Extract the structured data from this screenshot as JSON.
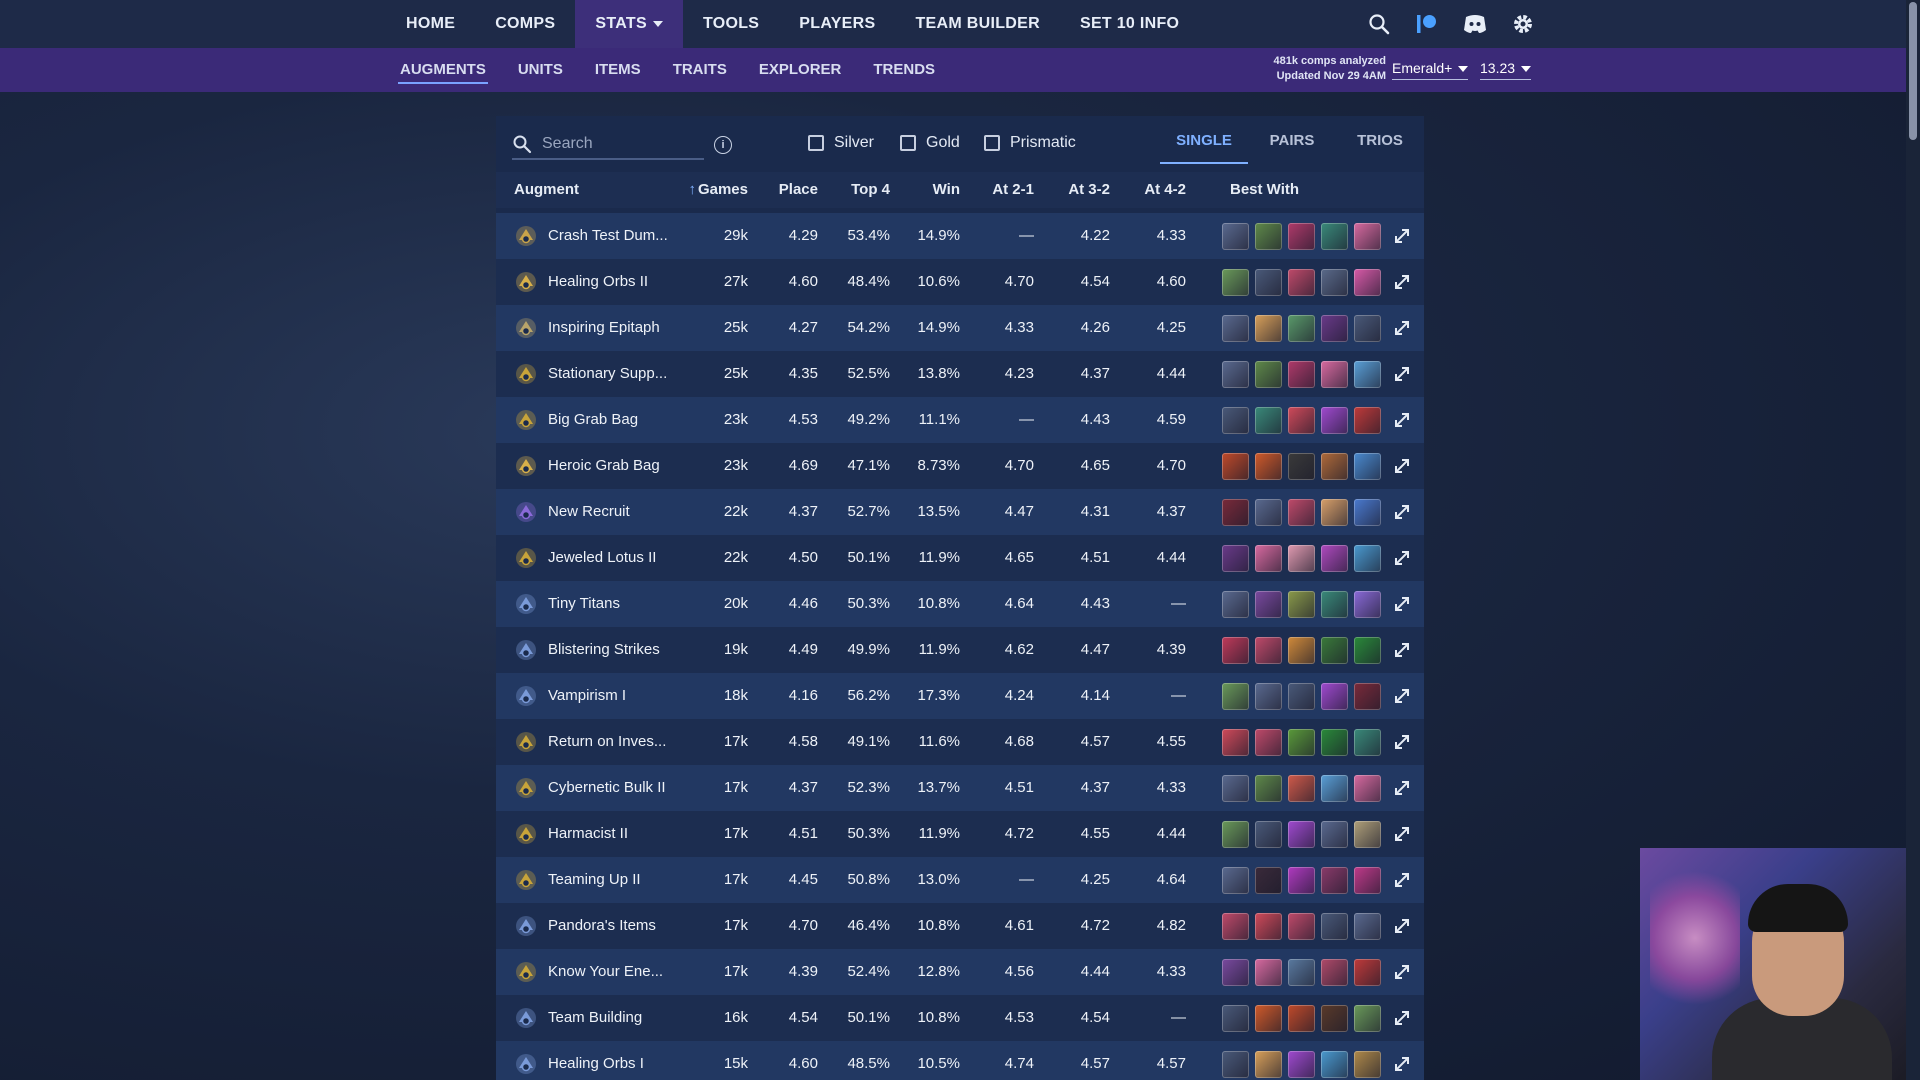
{
  "topnav": {
    "items": [
      {
        "label": "HOME"
      },
      {
        "label": "COMPS"
      },
      {
        "label": "STATS"
      },
      {
        "label": "TOOLS"
      },
      {
        "label": "PLAYERS"
      },
      {
        "label": "TEAM BUILDER"
      },
      {
        "label": "SET 10 INFO"
      }
    ],
    "active": "STATS"
  },
  "subnav": {
    "items": [
      {
        "label": "AUGMENTS"
      },
      {
        "label": "UNITS"
      },
      {
        "label": "ITEMS"
      },
      {
        "label": "TRAITS"
      },
      {
        "label": "EXPLORER"
      },
      {
        "label": "TRENDS"
      }
    ],
    "meta_line1": "481k comps analyzed",
    "meta_line2": "Updated Nov 29 4AM",
    "rank_filter": "Emerald+",
    "patch": "13.23"
  },
  "toolbar": {
    "search_placeholder": "Search",
    "filters": [
      {
        "label": "Silver"
      },
      {
        "label": "Gold"
      },
      {
        "label": "Prismatic"
      }
    ],
    "modes": [
      {
        "label": "SINGLE"
      },
      {
        "label": "PAIRS"
      },
      {
        "label": "TRIOS"
      }
    ]
  },
  "columns": {
    "augment": "Augment",
    "games": "Games",
    "place": "Place",
    "top4": "Top 4",
    "win": "Win",
    "at21": "At 2-1",
    "at32": "At 3-2",
    "at42": "At 4-2",
    "best": "Best With"
  },
  "rows": [
    {
      "name": "Crash Test Dum...",
      "games": "29k",
      "place": "4.29",
      "top4": "53.4%",
      "win": "14.9%",
      "at21": "—",
      "at32": "4.22",
      "at42": "4.33",
      "icon_color": "#c9a44a",
      "champs": [
        "#5a6a90",
        "#5f8a4a",
        "#b03a6a",
        "#3a8a7a",
        "#d86aa0"
      ]
    },
    {
      "name": "Healing Orbs II",
      "games": "27k",
      "place": "4.60",
      "top4": "48.4%",
      "win": "10.6%",
      "at21": "4.70",
      "at32": "4.54",
      "at42": "4.60",
      "icon_color": "#d8b04a",
      "champs": [
        "#6a9a5a",
        "#4a5a7a",
        "#c04a6a",
        "#5a6a8a",
        "#d85aa8"
      ]
    },
    {
      "name": "Inspiring Epitaph",
      "games": "25k",
      "place": "4.27",
      "top4": "54.2%",
      "win": "14.9%",
      "at21": "4.33",
      "at32": "4.26",
      "at42": "4.25",
      "icon_color": "#b8a46a",
      "champs": [
        "#5a6a90",
        "#d8a05a",
        "#5a9a6a",
        "#6a3a8a",
        "#4a5a7a"
      ]
    },
    {
      "name": "Stationary Supp...",
      "games": "25k",
      "place": "4.35",
      "top4": "52.5%",
      "win": "13.8%",
      "at21": "4.23",
      "at32": "4.37",
      "at42": "4.44",
      "icon_color": "#c8a43a",
      "champs": [
        "#5a6a90",
        "#5f8a4a",
        "#b03a6a",
        "#d86aa0",
        "#5aa0d8"
      ]
    },
    {
      "name": "Big Grab Bag",
      "games": "23k",
      "place": "4.53",
      "top4": "49.2%",
      "win": "11.1%",
      "at21": "—",
      "at32": "4.43",
      "at42": "4.59",
      "icon_color": "#c8a43a",
      "champs": [
        "#4a5a7a",
        "#3a8a7a",
        "#d04a5a",
        "#a04ad0",
        "#c03a3a"
      ]
    },
    {
      "name": "Heroic Grab Bag",
      "games": "23k",
      "place": "4.69",
      "top4": "47.1%",
      "win": "8.73%",
      "at21": "4.70",
      "at32": "4.65",
      "at42": "4.70",
      "icon_color": "#d8b04a",
      "champs": [
        "#c04a2a",
        "#d05a2a",
        "#3a3a3a",
        "#b06a3a",
        "#4a8ad0"
      ]
    },
    {
      "name": "New Recruit",
      "games": "22k",
      "place": "4.37",
      "top4": "52.7%",
      "win": "13.5%",
      "at21": "4.47",
      "at32": "4.31",
      "at42": "4.37",
      "icon_color": "#8a6ad8",
      "champs": [
        "#7a2a3a",
        "#5a6a90",
        "#c04a6a",
        "#d8a06a",
        "#4a7ad0"
      ]
    },
    {
      "name": "Jeweled Lotus II",
      "games": "22k",
      "place": "4.50",
      "top4": "50.1%",
      "win": "11.9%",
      "at21": "4.65",
      "at32": "4.51",
      "at42": "4.44",
      "icon_color": "#c8a43a",
      "champs": [
        "#6a3a8a",
        "#d86aa0",
        "#e09ab0",
        "#b04ac0",
        "#4a9ad0"
      ]
    },
    {
      "name": "Tiny Titans",
      "games": "20k",
      "place": "4.46",
      "top4": "50.3%",
      "win": "10.8%",
      "at21": "4.64",
      "at32": "4.43",
      "at42": "—",
      "icon_color": "#7a9ad8",
      "champs": [
        "#5a6a90",
        "#7a4aa0",
        "#8a9a4a",
        "#3a8a7a",
        "#8a6ad8"
      ]
    },
    {
      "name": "Blistering Strikes",
      "games": "19k",
      "place": "4.49",
      "top4": "49.9%",
      "win": "11.9%",
      "at21": "4.62",
      "at32": "4.47",
      "at42": "4.39",
      "icon_color": "#7a9ad8",
      "champs": [
        "#c03a5a",
        "#c04a6a",
        "#d08a3a",
        "#3a7a3a",
        "#2a8a3a"
      ]
    },
    {
      "name": "Vampirism I",
      "games": "18k",
      "place": "4.16",
      "top4": "56.2%",
      "win": "17.3%",
      "at21": "4.24",
      "at32": "4.14",
      "at42": "—",
      "icon_color": "#7a9ad8",
      "champs": [
        "#6a9a5a",
        "#5a6a90",
        "#4a5a7a",
        "#a04ad0",
        "#7a2a3a"
      ]
    },
    {
      "name": "Return on Inves...",
      "games": "17k",
      "place": "4.58",
      "top4": "49.1%",
      "win": "11.6%",
      "at21": "4.68",
      "at32": "4.57",
      "at42": "4.55",
      "icon_color": "#c8a43a",
      "champs": [
        "#d04a5a",
        "#c04a6a",
        "#5a9a3a",
        "#2a8a3a",
        "#3a8a7a"
      ]
    },
    {
      "name": "Cybernetic Bulk II",
      "games": "17k",
      "place": "4.37",
      "top4": "52.3%",
      "win": "13.7%",
      "at21": "4.51",
      "at32": "4.37",
      "at42": "4.33",
      "icon_color": "#c8a43a",
      "champs": [
        "#5a6a90",
        "#5f8a4a",
        "#d05a4a",
        "#5aa0d8",
        "#d86aa0"
      ]
    },
    {
      "name": "Harmacist II",
      "games": "17k",
      "place": "4.51",
      "top4": "50.3%",
      "win": "11.9%",
      "at21": "4.72",
      "at32": "4.55",
      "at42": "4.44",
      "icon_color": "#c8a43a",
      "champs": [
        "#6a9a5a",
        "#4a5a7a",
        "#a04ad0",
        "#5a6a90",
        "#b0a07a"
      ]
    },
    {
      "name": "Teaming Up II",
      "games": "17k",
      "place": "4.45",
      "top4": "50.8%",
      "win": "13.0%",
      "at21": "—",
      "at32": "4.25",
      "at42": "4.64",
      "icon_color": "#c8a43a",
      "champs": [
        "#5a6a90",
        "#3a2a3a",
        "#b03ac0",
        "#8a3a6a",
        "#c03a8a"
      ]
    },
    {
      "name": "Pandora's Items",
      "games": "17k",
      "place": "4.70",
      "top4": "46.4%",
      "win": "10.8%",
      "at21": "4.61",
      "at32": "4.72",
      "at42": "4.82",
      "icon_color": "#7a9ad8",
      "champs": [
        "#c04a6a",
        "#d04a5a",
        "#c04a6a",
        "#4a5a7a",
        "#5a6a90"
      ]
    },
    {
      "name": "Know Your Ene...",
      "games": "17k",
      "place": "4.39",
      "top4": "52.4%",
      "win": "12.8%",
      "at21": "4.56",
      "at32": "4.44",
      "at42": "4.33",
      "icon_color": "#c8a43a",
      "champs": [
        "#7a4aa0",
        "#d86aa0",
        "#5a7aa0",
        "#b04a6a",
        "#c03a3a"
      ]
    },
    {
      "name": "Team Building",
      "games": "16k",
      "place": "4.54",
      "top4": "50.1%",
      "win": "10.8%",
      "at21": "4.53",
      "at32": "4.54",
      "at42": "—",
      "icon_color": "#7a9ad8",
      "champs": [
        "#4a5a7a",
        "#d05a2a",
        "#c04a2a",
        "#5a3a2a",
        "#6a9a5a"
      ]
    },
    {
      "name": "Healing Orbs I",
      "games": "15k",
      "place": "4.60",
      "top4": "48.5%",
      "win": "10.5%",
      "at21": "4.74",
      "at32": "4.57",
      "at42": "4.57",
      "icon_color": "#7a9ad8",
      "champs": [
        "#4a5a7a",
        "#d8a05a",
        "#a04ad0",
        "#4a9ad0",
        "#b08a4a"
      ]
    }
  ]
}
